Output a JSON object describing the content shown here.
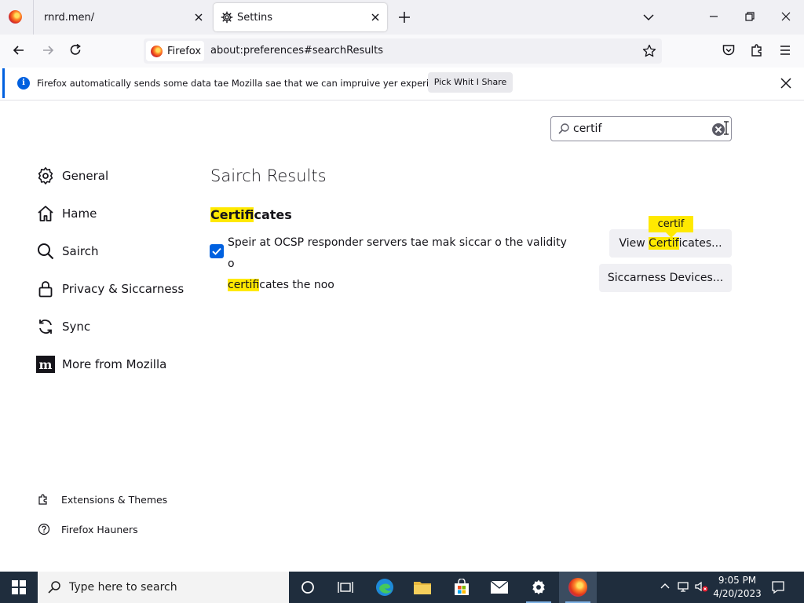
{
  "tabs": [
    {
      "title": "rnrd.men/",
      "icon": "firefox-icon"
    },
    {
      "title": "Settins",
      "icon": "gear-icon",
      "active": true
    }
  ],
  "navbar": {
    "identity_label": "Firefox",
    "url": "about:preferences#searchResults"
  },
  "notification": {
    "text": "Firefox automatically sends some data tae Mozilla sae that we can impruive yer experience.",
    "button": "Pick Whit I Share"
  },
  "search": {
    "value": "certif"
  },
  "sidebar": {
    "items": [
      {
        "label": "General",
        "icon": "gear-icon"
      },
      {
        "label": "Hame",
        "icon": "home-icon"
      },
      {
        "label": "Sairch",
        "icon": "search-icon"
      },
      {
        "label": "Privacy & Siccarness",
        "icon": "lock-icon"
      },
      {
        "label": "Sync",
        "icon": "sync-icon"
      },
      {
        "label": "More from Mozilla",
        "icon": "mozilla-icon"
      }
    ],
    "footer": [
      {
        "label": "Extensions & Themes",
        "icon": "puzzle-icon"
      },
      {
        "label": "Firefox Hauners",
        "icon": "help-icon"
      }
    ]
  },
  "main": {
    "results_title": "Sairch Results",
    "section": {
      "hl": "Certif",
      "rest": "icates"
    },
    "ocsp": {
      "line1": "Speir at OCSP responder servers tae mak siccar o the validity o",
      "line2_hl": "certif",
      "line2_rest": "icates the noo",
      "checked": true
    },
    "tooltip": "certif",
    "view_certs": {
      "pre": "View ",
      "hl": "Certif",
      "post": "icates..."
    },
    "devices": "Siccarness Devices..."
  },
  "taskbar": {
    "search_placeholder": "Type here to search",
    "time": "9:05 PM",
    "date": "4/20/2023"
  },
  "colors": {
    "accent": "#0061e0",
    "highlight": "#ffe900",
    "taskbar": "#1f2d3d"
  }
}
